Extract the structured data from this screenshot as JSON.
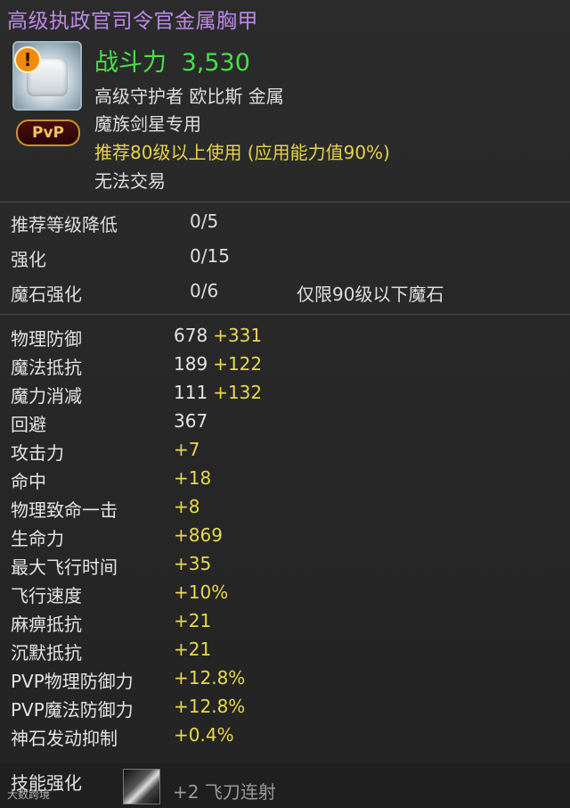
{
  "item": {
    "title": "高级执政官司令官金属胸甲",
    "combat_power_label": "战斗力",
    "combat_power_value": "3,530",
    "pvp_badge": "PvP",
    "warning_icon": "!",
    "info": [
      "高级守护者 欧比斯 金属",
      "魔族剑星专用",
      "推荐80级以上使用 (应用能力值90%)",
      "无法交易"
    ]
  },
  "enchant": [
    {
      "label": "推荐等级降低",
      "value": "0/5",
      "note": ""
    },
    {
      "label": "强化",
      "value": "0/15",
      "note": ""
    },
    {
      "label": "魔石强化",
      "value": "0/6",
      "note": "仅限90级以下魔石"
    }
  ],
  "stats": [
    {
      "name": "物理防御",
      "base": "678",
      "bonus": "+331"
    },
    {
      "name": "魔法抵抗",
      "base": "189",
      "bonus": "+122"
    },
    {
      "name": "魔力消减",
      "base": "111",
      "bonus": "+132"
    },
    {
      "name": "回避",
      "base": "367",
      "bonus": ""
    },
    {
      "name": "攻击力",
      "base": "",
      "bonus": "+7"
    },
    {
      "name": "命中",
      "base": "",
      "bonus": "+18"
    },
    {
      "name": "物理致命一击",
      "base": "",
      "bonus": "+8"
    },
    {
      "name": "生命力",
      "base": "",
      "bonus": "+869"
    },
    {
      "name": "最大飞行时间",
      "base": "",
      "bonus": "+35"
    },
    {
      "name": "飞行速度",
      "base": "",
      "bonus": "+10%"
    },
    {
      "name": "麻痹抵抗",
      "base": "",
      "bonus": "+21"
    },
    {
      "name": "沉默抵抗",
      "base": "",
      "bonus": "+21"
    },
    {
      "name": "PVP物理防御力",
      "base": "",
      "bonus": "+12.8%"
    },
    {
      "name": "PVP魔法防御力",
      "base": "",
      "bonus": "+12.8%"
    },
    {
      "name": "神石发动抑制",
      "base": "",
      "bonus": "+0.4%"
    }
  ],
  "skill": {
    "label": "技能强化",
    "text": "+2 飞刀连射"
  },
  "watermark": "大数跨境",
  "colors": {
    "title": "#b989e8",
    "combat_power": "#46e04a",
    "bonus": "#e8d94a",
    "background": "#262626"
  }
}
